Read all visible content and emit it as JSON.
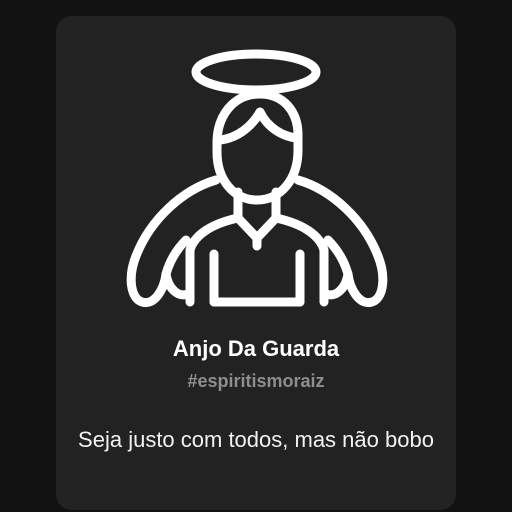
{
  "card": {
    "icon": "angel-icon",
    "title": "Anjo Da Guarda",
    "hashtag": "#espiritismoraiz",
    "quote": "Seja justo com todos, mas não bobo"
  },
  "colors": {
    "background": "#121212",
    "card": "#222222",
    "title": "#ffffff",
    "hashtag": "#8e8e8e"
  }
}
